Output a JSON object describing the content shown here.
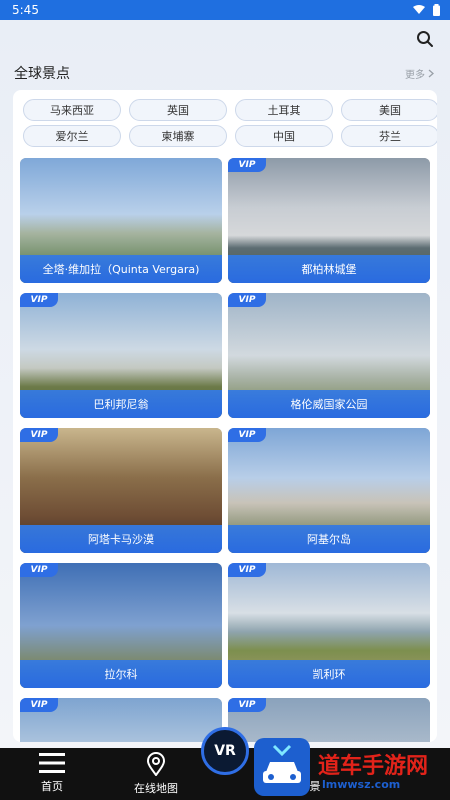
{
  "status_bar": {
    "time": "5:45"
  },
  "header": {
    "title": "全球景点",
    "more_label": "更多"
  },
  "chips": [
    "马来西亚",
    "英国",
    "土耳其",
    "美国",
    "爱尔兰",
    "柬埔寨",
    "中国",
    "芬兰"
  ],
  "tiles": [
    {
      "label": "全塔·维加拉（Quinta Vergara)",
      "vip": false
    },
    {
      "label": "都柏林城堡",
      "vip": true
    },
    {
      "label": "巴利邦尼翁",
      "vip": true
    },
    {
      "label": "格伦威国家公园",
      "vip": true
    },
    {
      "label": "阿塔卡马沙漠",
      "vip": true
    },
    {
      "label": "阿基尔岛",
      "vip": true
    },
    {
      "label": "拉尔科",
      "vip": true
    },
    {
      "label": "凯利环",
      "vip": true
    },
    {
      "label": "",
      "vip": true
    },
    {
      "label": "",
      "vip": true
    }
  ],
  "vip_badge": "VIP",
  "bottom_nav": {
    "home": "首页",
    "map": "在线地图",
    "vr": "VR",
    "third_tail": "景"
  },
  "watermark": {
    "text": "道车手游网",
    "url": "lmwwsz.com"
  },
  "colors": {
    "accent": "#2f6ee5",
    "statusbar": "#1f6fe0",
    "bottom": "#111111"
  }
}
